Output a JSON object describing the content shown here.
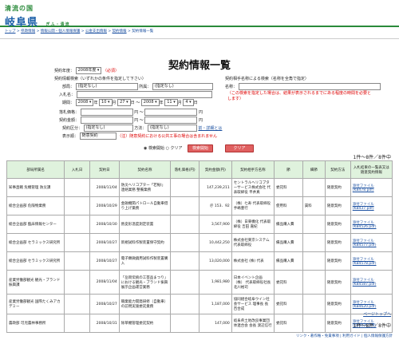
{
  "header": {
    "logo_line1": "清流の国",
    "logo_line2": "岐阜県",
    "logo_tag": "ぎふ・清流"
  },
  "breadcrumb": [
    "トップ",
    "県政情報",
    "情報公開・個人情報保護",
    "公金支出情報",
    "契約情報",
    "契約情報一覧"
  ],
  "page_title": "契約情報一覧",
  "search": {
    "fiscal_year_label": "契約年度：",
    "fiscal_year_value": "2008年度",
    "required_mark": "（必須）",
    "left_heading": "契約情報検索（いずれかの条件を指定して下さい）",
    "right_heading": "契約相手名称による検索（名称を全角で指定）",
    "dept_label": "部局：",
    "dept_value": "(指定なし)",
    "section_label": "所属：",
    "section_value": "(指定なし)",
    "keyword_label": "入札名：",
    "period_label": "期間：",
    "contract_type_label": "契約区分：",
    "date_from": {
      "y": "2008",
      "m": "10",
      "d": "27"
    },
    "date_to": {
      "y": "2008",
      "m": "11",
      "d": "4"
    },
    "amount_label": "落札価格：",
    "amount_unit": "円",
    "contract_amount_label": "契約金額：",
    "method_value": "(指定なし)",
    "method_label": "方法：",
    "search_detail_link": "前・詳細とは",
    "display_label": "表示順：",
    "display_value": "随意契約",
    "display_note": "（注）随意契約における公共工事の場合は含まれません",
    "name_label": "名称：",
    "name_note": "（この検索を指定した場合は、結果が表示されるまでにある程度の時間を必要とします）",
    "radio_start": "検索開始",
    "radio_clear": "クリア",
    "btn_start": "検索開始",
    "btn_clear": "クリア"
  },
  "result_count_top": "1件～8件／8件中",
  "result_count_bottom": "1件～8件／8件中",
  "table": {
    "headers": [
      "部局所属名",
      "入札日",
      "契約日",
      "契約名称",
      "落札価格(円)",
      "契約金額(円)",
      "契約相手方名称",
      "節",
      "細節",
      "契約方法",
      "入札結果の一覧表又は随意契約情報"
    ],
    "rows": [
      [
        "知事直轄 危機管理 防災課",
        "",
        "2008/11/04",
        "防災ヘリコプター「若鮎Ⅰ」連絡業務 整備業務",
        "",
        "147,239,211",
        "セントラルヘリコプターサービス株式会社 代表取締役 平井真",
        "委託料",
        "",
        "随意契約",
        "添付ファイル(KB478.pdf)"
      ],
      [
        "総合企画部 危険物業務",
        "",
        "2008/10/29",
        "金融機関パトロール自動車借り上げ業務",
        "",
        "＠ 153．92",
        "（株）七寿 代表取締役 手嶋豊行",
        "使用料",
        "賃料",
        "随意契約",
        "添付ファイル(KB437.pdf)"
      ],
      [
        "総合企画部 臨床情報センター",
        "",
        "2008/10/30",
        "熱変形温度測定装置",
        "",
        "3,567,900",
        "（株）日東機化 代表取締役 吉田 嘉紀",
        "備品購入費",
        "",
        "随意契約",
        "添付ファイル(KB4526.pdf)"
      ],
      [
        "総合企画部 セラミックス研究所",
        "",
        "2008/10/27",
        "新規試料作製装置保守契約",
        "",
        "10,442,250",
        "株式会社東京システム 代表取締役",
        "備品購入費",
        "",
        "随意契約",
        "添付ファイル(KB4577.pdf)"
      ],
      [
        "総合企画部 セラミックス研究所",
        "",
        "2008/10/27",
        "電子顕微鏡用試料作製装置購入",
        "",
        "13,020,000",
        "株式会社 (株) 代表",
        "備品購入費",
        "",
        "随意契約",
        "添付ファイル(KB4578.pdf)"
      ],
      [
        "産業労働部観光 観光・ブランド振興課",
        "",
        "2008/11/04",
        "「岳岡伝統の工芸品まつり」における観光・ブランド振興展示企画運営業務",
        "",
        "1,981,980",
        "日本イベント企画（株） 代表取締役社長 北川裕司",
        "委託料",
        "",
        "随意契約",
        "添付ファイル(KB4587.pdf)"
      ],
      [
        "産業労働部観光 国際たくみアカデミー",
        "",
        "2008/10/27",
        "職業能力開発研修（自動車）の訪問実施委託業務",
        "",
        "1,187,000",
        "協同組合岐阜ウイン社会サービス 理事長 長 百合成",
        "委託料",
        "",
        "随意契約",
        "添付ファイル(KB4620.pdf)"
      ],
      [
        "農政部 可児農林事務所",
        "",
        "2008/10/31",
        "除草機管理委託契約",
        "",
        "147,000",
        "岐阜県土地改良事業団体連合会 会長 渡辺信行",
        "委託料",
        "",
        "随意契約",
        "添付ファイル(KB4676.pdf)"
      ]
    ]
  },
  "page_top_link": "ページトップへ",
  "footer_links": "リンク・著作権・免責事項 | 利用ガイド | 個人情報保護方針"
}
